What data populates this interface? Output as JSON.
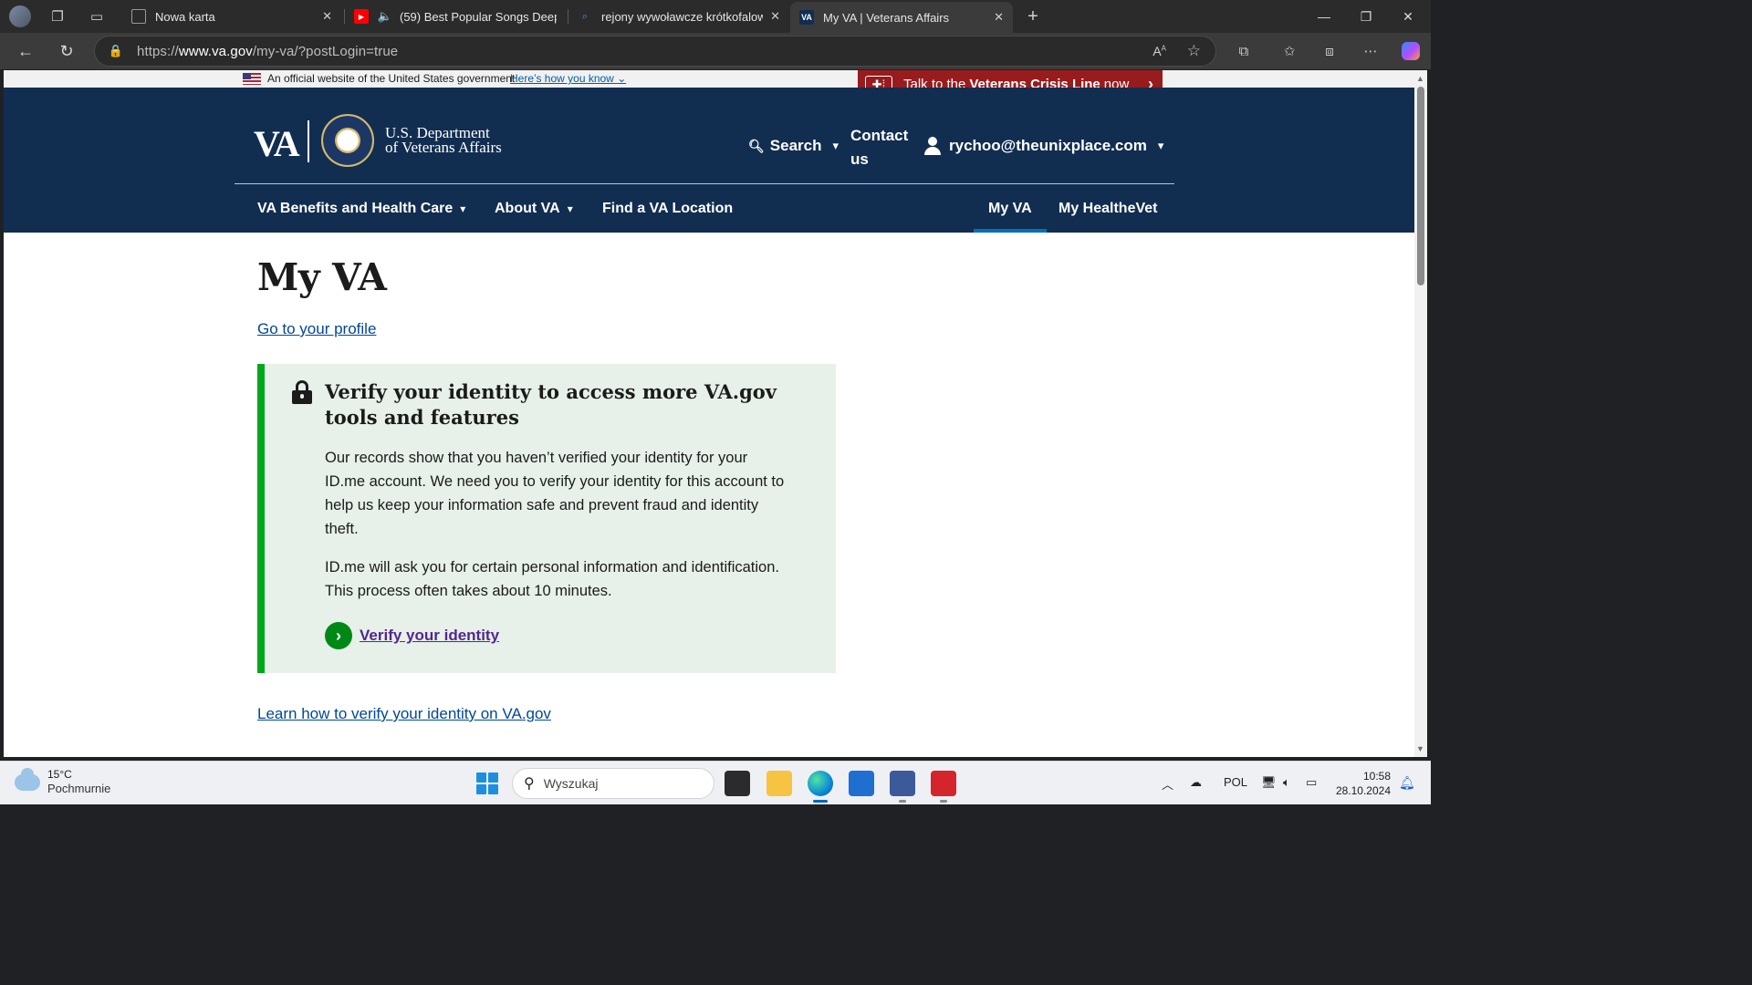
{
  "browser": {
    "tabs": [
      {
        "title": "Nowa karta",
        "icon": "newtab-icon"
      },
      {
        "title": "(59) Best Popular Songs Deep",
        "icon": "youtube-icon",
        "audio": true
      },
      {
        "title": "rejony wywoławcze krótkofalowców",
        "icon": "search-icon"
      },
      {
        "title": "My VA | Veterans Affairs",
        "icon": "va-icon",
        "active": true
      }
    ],
    "favicon_va_text": "VA",
    "url_prefix": "https://",
    "url_host": "www.va.gov",
    "url_path": "/my-va/?postLogin=true",
    "read_aloud_label": "A"
  },
  "va": {
    "gov_banner": {
      "text": "An official website of the United States government",
      "link": "Here’s how you know"
    },
    "crisis_line": {
      "prefix": "Talk to the",
      "bold": "Veterans Crisis Line",
      "suffix": "now"
    },
    "logo": {
      "va": "VA",
      "dept_line1": "U.S. Department",
      "dept_line2": "of Veterans Affairs"
    },
    "header": {
      "search": "Search",
      "contact": "Contact us",
      "user": "rychoo@theunixplace.com"
    },
    "nav": {
      "benefits": "VA Benefits and Health Care",
      "about": "About VA",
      "find_location": "Find a VA Location",
      "my_va": "My VA",
      "my_healthevet": "My HealtheVet"
    },
    "page": {
      "title": "My VA",
      "profile_link": "Go to your profile",
      "alert_heading": "Verify your identity to access more VA.gov tools and features",
      "alert_p1": "Our records show that you haven’t verified your identity for your ID.me account. We need you to verify your identity for this account to help us keep your information safe and prevent fraud and identity theft.",
      "alert_p2": "ID.me will ask you for certain personal information and identification. This process often takes about 10 minutes.",
      "verify_link": "Verify your identity",
      "learn_link": "Learn how to verify your identity on VA.gov"
    }
  },
  "taskbar": {
    "weather_temp": "15°C",
    "weather_desc": "Pochmurnie",
    "search_placeholder": "Wyszukaj",
    "language": "POL",
    "time": "10:58",
    "date": "28.10.2024"
  },
  "colors": {
    "va_navy": "#112e51",
    "crisis_red": "#981b1e",
    "alert_green": "#00a91c",
    "alert_bg": "#e7f0e9",
    "link_blue": "#004795",
    "visited_purple": "#54278f"
  }
}
